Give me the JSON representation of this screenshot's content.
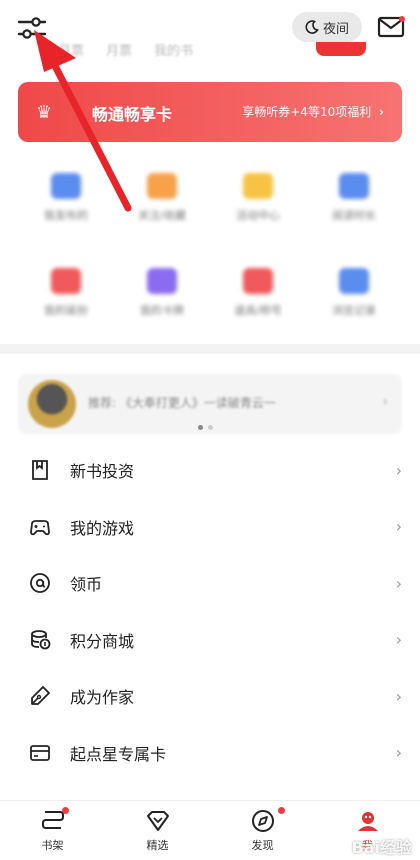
{
  "topbar": {
    "night_label": "夜间",
    "subtabs": [
      "月票",
      "月票",
      "我的书"
    ]
  },
  "vip": {
    "title": "畅通畅享卡",
    "perk": "享畅听券+4等10项福利",
    "perk_chev": "›"
  },
  "grid": {
    "items": [
      {
        "label": "我发布的",
        "color": "#5b8def"
      },
      {
        "label": "关注/收藏",
        "color": "#f7a24b"
      },
      {
        "label": "活动中心",
        "color": "#f6c344"
      },
      {
        "label": "阅读时长",
        "color": "#5b8def"
      },
      {
        "label": "我的装扮",
        "color": "#f05a5a"
      },
      {
        "label": "我的卡牌",
        "color": "#8b6cf0"
      },
      {
        "label": "道具/称号",
        "color": "#f05a5a"
      },
      {
        "label": "浏览记录",
        "color": "#5b8def"
      }
    ]
  },
  "promo": {
    "text": "推荐: 《大奉打更人》一读破青云一",
    "chev": "›"
  },
  "menu": {
    "items": [
      {
        "label": "新书投资",
        "icon": "bookmark-icon",
        "chev": "›"
      },
      {
        "label": "我的游戏",
        "icon": "gamepad-icon",
        "chev": "›"
      },
      {
        "label": "领币",
        "icon": "at-coin-icon",
        "chev": "›"
      },
      {
        "label": "积分商城",
        "icon": "coin-stack-icon",
        "chev": "›"
      },
      {
        "label": "成为作家",
        "icon": "pen-icon",
        "chev": "›"
      },
      {
        "label": "起点星专属卡",
        "icon": "card-icon",
        "chev": "›"
      }
    ]
  },
  "nav": {
    "items": [
      {
        "label": "书架"
      },
      {
        "label": "精选"
      },
      {
        "label": "发现"
      },
      {
        "label": "我"
      }
    ],
    "active_color": "#e33333"
  },
  "watermark": "Bai经验"
}
